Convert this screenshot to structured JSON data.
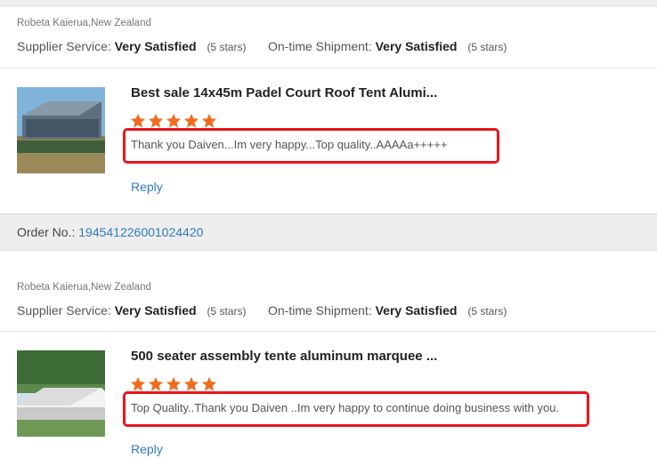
{
  "reviews": [
    {
      "buyer": "Robeta Kaierua,New Zealand",
      "supplier_label": "Supplier Service:",
      "supplier_value": "Very Satisfied",
      "supplier_stars": "(5 stars)",
      "shipment_label": "On-time Shipment:",
      "shipment_value": "Very Satisfied",
      "shipment_stars": "(5 stars)",
      "product_title": "Best sale 14x45m Padel Court Roof Tent Alumi...",
      "rating": 5,
      "comment": "Thank you Daiven...Im very happy...Top quality..AAAAa+++++",
      "reply": "Reply"
    },
    {
      "buyer": "Robeta Kaierua,New Zealand",
      "supplier_label": "Supplier Service:",
      "supplier_value": "Very Satisfied",
      "supplier_stars": "(5 stars)",
      "shipment_label": "On-time Shipment:",
      "shipment_value": "Very Satisfied",
      "shipment_stars": "(5 stars)",
      "product_title": "500 seater assembly tente aluminum marquee ...",
      "rating": 5,
      "comment": "Top Quality..Thank you Daiven ..Im very happy to continue doing business with you.",
      "reply": "Reply"
    }
  ],
  "order": {
    "label": "Order No.:",
    "number": "194541226001024420"
  },
  "colors": {
    "star": "#f26b1d",
    "highlight": "#e8141f",
    "link": "#2f7cc1"
  }
}
